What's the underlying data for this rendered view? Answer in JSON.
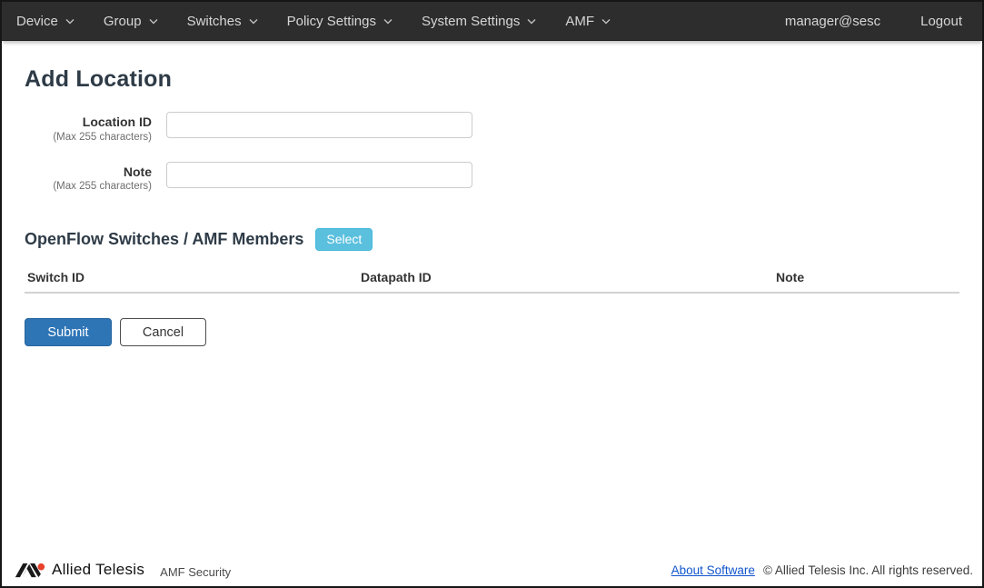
{
  "colors": {
    "navbar-bg": "#2d2d2d",
    "navbar-fg": "#d6d6d6",
    "heading": "#2e3b47",
    "primary": "#2e75b6",
    "info": "#5bc0de",
    "link": "#1155cc"
  },
  "navbar": {
    "items": [
      {
        "label": "Device"
      },
      {
        "label": "Group"
      },
      {
        "label": "Switches"
      },
      {
        "label": "Policy Settings"
      },
      {
        "label": "System Settings"
      },
      {
        "label": "AMF"
      }
    ],
    "user": "manager@sesc",
    "logout_label": "Logout"
  },
  "page": {
    "title": "Add Location"
  },
  "form": {
    "fields": [
      {
        "label": "Location ID",
        "hint": "(Max 255 characters)",
        "value": ""
      },
      {
        "label": "Note",
        "hint": "(Max 255 characters)",
        "value": ""
      }
    ]
  },
  "members_section": {
    "title": "OpenFlow Switches / AMF Members",
    "select_label": "Select",
    "table": {
      "columns": [
        "Switch ID",
        "Datapath ID",
        "Note"
      ],
      "rows": []
    }
  },
  "actions": {
    "submit_label": "Submit",
    "cancel_label": "Cancel"
  },
  "footer": {
    "brand": "Allied Telesis",
    "app_name": "AMF Security",
    "about_link": "About Software",
    "copyright": "© Allied Telesis Inc. All rights reserved."
  }
}
